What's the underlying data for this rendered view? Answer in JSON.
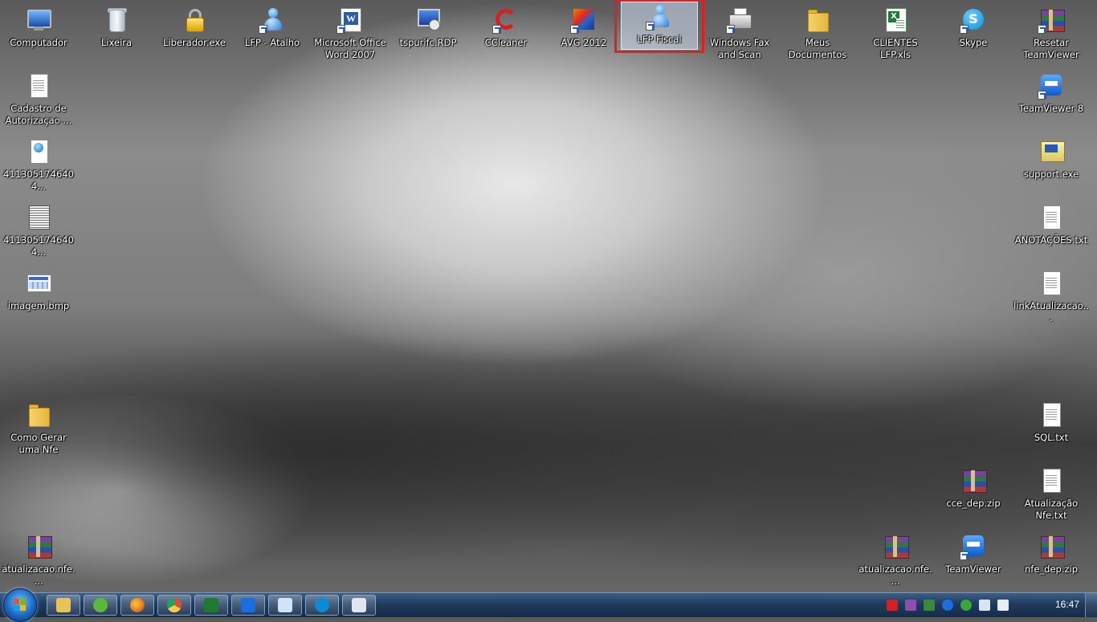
{
  "desktop": {
    "icons": [
      {
        "label": "Computador",
        "icon": "computer-icon"
      },
      {
        "label": "Lixeira",
        "icon": "recycle-bin-icon"
      },
      {
        "label": "Liberador.exe",
        "icon": "padlock-icon"
      },
      {
        "label": "LFP - Atalho",
        "icon": "user-shortcut-icon"
      },
      {
        "label": "Microsoft Office Word 2007",
        "icon": "word-icon"
      },
      {
        "label": "tspurifc.RDP",
        "icon": "remote-desktop-icon"
      },
      {
        "label": "CCleaner",
        "icon": "ccleaner-icon"
      },
      {
        "label": "AVG 2012",
        "icon": "avg-icon"
      },
      {
        "label": "LFP Fiscal",
        "icon": "user-shortcut-icon",
        "selected": true
      },
      {
        "label": "Windows Fax and Scan",
        "icon": "fax-icon"
      },
      {
        "label": "Meus Documentos",
        "icon": "folder-icon"
      },
      {
        "label": "CLIENTES LFP.xls",
        "icon": "excel-icon"
      },
      {
        "label": "Skype",
        "icon": "skype-icon"
      },
      {
        "label": "Resetar TeamViewer",
        "icon": "winrar-icon"
      },
      {
        "label": "Cadastro de Autorizaçao ...",
        "icon": "document-icon"
      },
      {
        "label": "4113051746404...",
        "icon": "web-document-icon"
      },
      {
        "label": "4113051746404...",
        "icon": "scanned-document-icon"
      },
      {
        "label": "imagem.bmp",
        "icon": "bitmap-icon"
      },
      {
        "label": "Como Gerar uma Nfe",
        "icon": "folder-icon"
      },
      {
        "label": "atualizacao.nfe....",
        "icon": "winrar-icon"
      },
      {
        "label": "TeamViewer 8",
        "icon": "teamviewer-icon"
      },
      {
        "label": "support.exe",
        "icon": "support-icon"
      },
      {
        "label": "ANOTAÇÕES.txt",
        "icon": "text-file-icon"
      },
      {
        "label": "linkAtualizacao...",
        "icon": "text-file-icon"
      },
      {
        "label": "SQL.txt",
        "icon": "text-file-icon"
      },
      {
        "label": "cce_dep.zip",
        "icon": "winrar-icon"
      },
      {
        "label": "Atualização Nfe.txt",
        "icon": "text-file-icon"
      },
      {
        "label": "atualizacao.nfe....",
        "icon": "winrar-icon"
      },
      {
        "label": "TeamViewer",
        "icon": "teamviewer-icon"
      },
      {
        "label": "nfe_dep.zip",
        "icon": "winrar-icon"
      }
    ]
  },
  "taskbar": {
    "pinned": [
      {
        "name": "windows-explorer",
        "icon": "explorer-icon",
        "color": "#e8c35a"
      },
      {
        "name": "utorrent",
        "icon": "utorrent-icon",
        "color": "#5cb83a"
      },
      {
        "name": "firefox",
        "icon": "firefox-icon",
        "color": "#e8761c"
      },
      {
        "name": "chrome",
        "icon": "chrome-icon",
        "color": "#dd4b39"
      },
      {
        "name": "excel",
        "icon": "excel-icon",
        "color": "#1e7a32"
      },
      {
        "name": "teamviewer",
        "icon": "teamviewer-icon",
        "color": "#1b6ee0"
      },
      {
        "name": "notepad",
        "icon": "notepad-icon",
        "color": "#cfe4f8"
      },
      {
        "name": "skype",
        "icon": "skype-icon",
        "color": "#0a8bd6"
      },
      {
        "name": "calculator",
        "icon": "calculator-icon",
        "color": "#dfe6ef"
      }
    ],
    "tray": [
      {
        "icon": "no-entry-icon",
        "color": "#d42020"
      },
      {
        "icon": "winrar-icon",
        "color": "#8a4fb0"
      },
      {
        "icon": "download-icon",
        "color": "#3a8a3a"
      },
      {
        "icon": "teamviewer-icon",
        "color": "#1b6ee0"
      },
      {
        "icon": "avg-icon",
        "color": "#3aa63a"
      },
      {
        "icon": "network-icon",
        "color": "#d8e4f0"
      },
      {
        "icon": "volume-icon",
        "color": "#e8eef5"
      }
    ],
    "clock": "16:47"
  }
}
